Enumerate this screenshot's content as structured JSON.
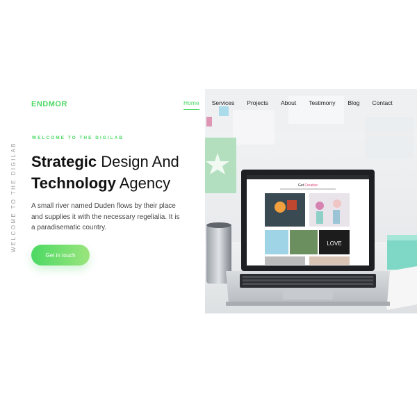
{
  "brand": {
    "name": "ENDMOR",
    "color": "#4cd964"
  },
  "nav": {
    "items": [
      {
        "label": "Home",
        "active": true
      },
      {
        "label": "Services"
      },
      {
        "label": "Projects"
      },
      {
        "label": "About"
      },
      {
        "label": "Testimony"
      },
      {
        "label": "Blog"
      },
      {
        "label": "Contact"
      }
    ]
  },
  "hero": {
    "side_text": "WELCOME TO THE DIGILAB",
    "eyebrow": "WELCOME TO THE DIGILAB",
    "headline": {
      "line1_bold": "Strategic",
      "line1_light": " Design And",
      "line2_bold": "Technology",
      "line2_light": " Agency"
    },
    "paragraph": "A small river named Duden flows by their place and supplies it with the necessary regelialia. It is a paradisematic country.",
    "cta_label": "Get in touch",
    "accent_color": "#4cd964"
  },
  "laptop_screen": {
    "heading_prefix": "Get",
    "heading_highlight": "Creative",
    "tile_text": "LOVE"
  }
}
